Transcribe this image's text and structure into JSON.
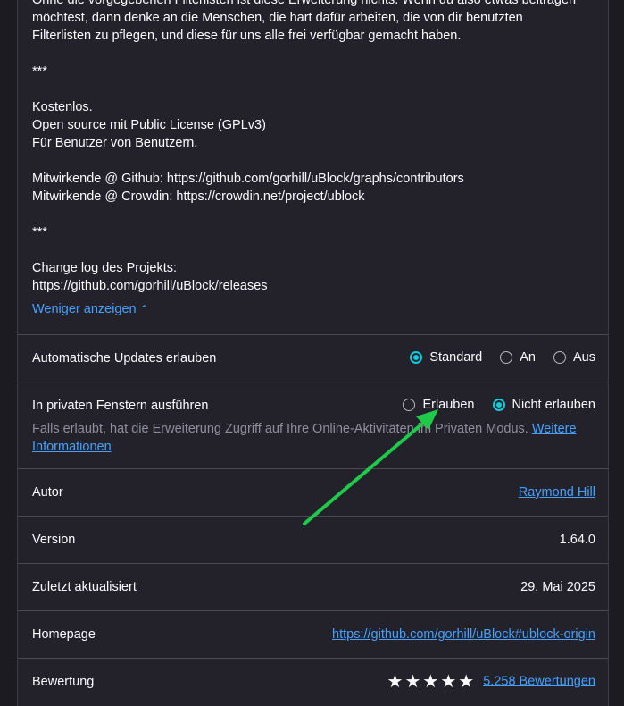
{
  "description": {
    "lines": [
      "Ohne die vorgegebenen Filterlisten ist diese Erweiterung nichts. Wenn du also etwas beitragen",
      "möchtest, dann denke an die Menschen, die hart dafür arbeiten, die von dir benutzten",
      "Filterlisten zu pflegen, und diese für uns alle frei verfügbar gemacht haben.",
      "",
      "***",
      "",
      "Kostenlos.",
      "Open source mit Public License (GPLv3)",
      "Für Benutzer von Benutzern.",
      "",
      "Mitwirkende @ Github: https://github.com/gorhill/uBlock/graphs/contributors",
      "Mitwirkende @ Crowdin: https://crowdin.net/project/ublock",
      "",
      "***",
      "",
      "Change log des Projekts:",
      "https://github.com/gorhill/uBlock/releases"
    ],
    "show_less": "Weniger anzeigen"
  },
  "auto_updates": {
    "label": "Automatische Updates erlauben",
    "options": [
      "Standard",
      "An",
      "Aus"
    ],
    "selected": "Standard"
  },
  "private_windows": {
    "label": "In privaten Fenstern ausführen",
    "options": [
      "Erlauben",
      "Nicht erlauben"
    ],
    "selected": "Nicht erlauben",
    "help_text": "Falls erlaubt, hat die Erweiterung Zugriff auf Ihre Online-Aktivitäten im Privaten Modus.",
    "help_link": "Weitere Informationen"
  },
  "author": {
    "label": "Autor",
    "value": "Raymond Hill"
  },
  "version": {
    "label": "Version",
    "value": "1.64.0"
  },
  "updated": {
    "label": "Zuletzt aktualisiert",
    "value": "29. Mai 2025"
  },
  "homepage": {
    "label": "Homepage",
    "value": "https://github.com/gorhill/uBlock#ublock-origin"
  },
  "rating": {
    "label": "Bewertung",
    "stars": 5,
    "reviews": "5.258 Bewertungen"
  },
  "colors": {
    "accent": "#0ccdda",
    "link": "#45a1ff",
    "background": "#1c1b22",
    "card": "#23222b",
    "arrow": "#1fc94a"
  }
}
